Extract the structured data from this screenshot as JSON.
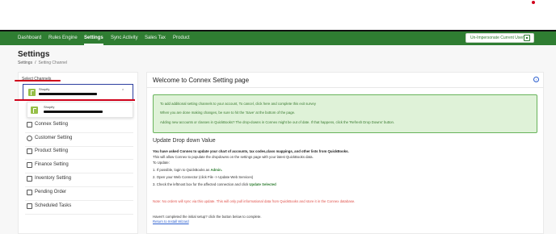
{
  "nav": {
    "items": [
      {
        "label": "Dashboard",
        "active": false
      },
      {
        "label": "Rules Engine",
        "active": false
      },
      {
        "label": "Settings",
        "active": true
      },
      {
        "label": "Sync Activity",
        "active": false
      },
      {
        "label": "Sales Tax",
        "active": false
      },
      {
        "label": "Product",
        "active": false
      }
    ],
    "impersonate_label": "Un-Impersonate Current User"
  },
  "page": {
    "title": "Settings",
    "breadcrumb": [
      "Settings",
      "Setting Channel"
    ]
  },
  "left": {
    "select_label": "Select Channels",
    "selected_option_label": "Shopify",
    "dropdown_option_label": "Shopify",
    "menu": [
      {
        "label": "Connex Setting",
        "icon": "bar-chart-icon"
      },
      {
        "label": "Customer Setting",
        "icon": "user-icon"
      },
      {
        "label": "Product Setting",
        "icon": "box-icon"
      },
      {
        "label": "Finance Setting",
        "icon": "finance-icon"
      },
      {
        "label": "Inventory Setting",
        "icon": "calendar-icon"
      },
      {
        "label": "Pending Order",
        "icon": "truck-icon"
      },
      {
        "label": "Scheduled Tasks",
        "icon": "clipboard-icon"
      }
    ]
  },
  "right": {
    "title": "Welcome to Connex Setting page",
    "notice": [
      "To add additional setting channels to your account, To cancel, click here and complete this exit survey",
      "When you are done making changes, be sure to hit the 'Save' at the bottom of the page.",
      "Adding new accounts or classes in QuickBooks? The drop-downs in Connex might be out of date. If that happens, click the 'Refresh Drop Downs' button."
    ],
    "section_title": "Update Drop down Value",
    "bold_intro": "You have asked Connex to update your chart of accounts, tax codes,class mappings, and other lists from QuickBooks.",
    "line2": "This will allow Connex to populate the dropdowns on the settings page with your latest QuickBooks data.",
    "line3": "To Update:",
    "step1_prefix": "1. If possible, login to QuickBooks as",
    "step1_bold": "Admin.",
    "step2": "2. Open your Web Connector (click File -> Update Web Services)",
    "step3_prefix": "3. Check the leftmost box for the affected connection and click",
    "step3_bold": "Update Selected",
    "warning": "Note: No orders will sync via this update. This will only pull informational data from QuickBooks and store it in the Connex database.",
    "initial_setup_question": "Haven't completed the initial setup? click the button below to complete.",
    "return_link": "Return to Install Wizard"
  },
  "colors": {
    "nav_green": "#2f7d32",
    "notice_bg": "#dff2d8",
    "annotation_red": "#d0021b",
    "select_border": "#2c3e9f"
  }
}
